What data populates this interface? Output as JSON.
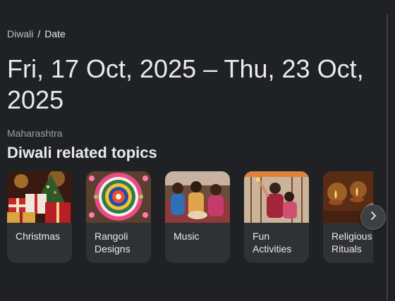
{
  "breadcrumb": {
    "parent": "Diwali",
    "separator": "/",
    "current": "Date"
  },
  "title": "Fri, 17 Oct, 2025 – Thu, 23 Oct, 2025",
  "region": "Maharashtra",
  "section_title": "Diwali related topics",
  "cards": [
    {
      "label": "Christmas",
      "image": "christmas-gifts-image"
    },
    {
      "label": "Rangoli Designs",
      "image": "rangoli-pattern-image"
    },
    {
      "label": "Music",
      "image": "music-celebration-image"
    },
    {
      "label": "Fun Activities",
      "image": "fun-activities-image"
    },
    {
      "label": "Religious Rituals",
      "image": "diya-lamps-image"
    }
  ],
  "next_icon": "chevron-right-icon"
}
